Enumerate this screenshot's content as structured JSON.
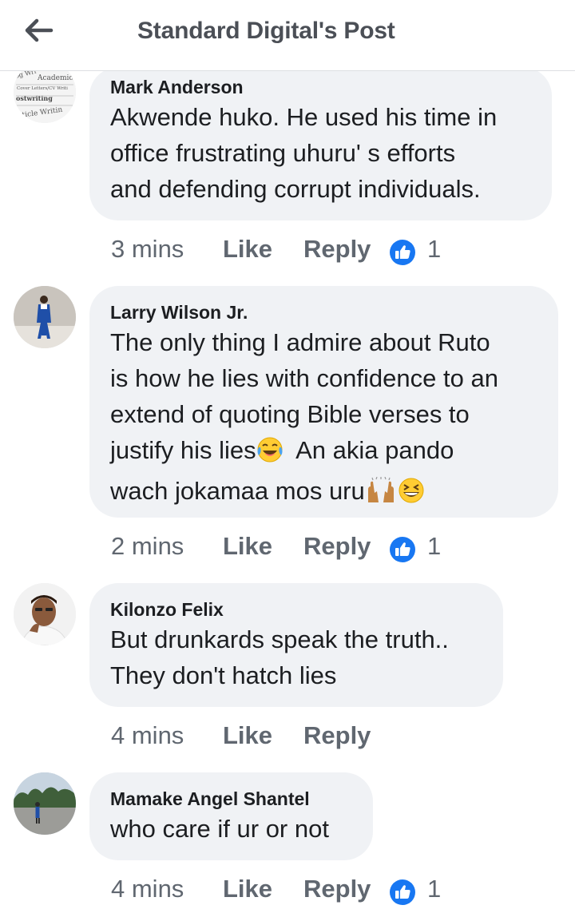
{
  "header": {
    "title": "Standard Digital's Post",
    "back_icon": "arrow-left-icon"
  },
  "colors": {
    "bubble": "#f0f2f5",
    "like_blue": "#1877f2",
    "meta_gray": "#606770"
  },
  "avatar_1_text": [
    "og Wri",
    "Academic",
    "Cover Letters/CV Writi",
    "ostwriting",
    "rticle Writin"
  ],
  "comments": [
    {
      "author": "Mark Anderson",
      "text": "Akwende huko. He used his time in\noffice frustrating uhuru' s efforts\nand defending corrupt individuals.",
      "time": "3 mins",
      "like": "Like",
      "reply": "Reply",
      "reaction_icon": "thumbs-up-icon",
      "reaction_count": "1"
    },
    {
      "author": "Larry Wilson Jr.",
      "text_parts": [
        "The only thing I admire about Ruto\nis how he lies with confidence to an\nextend of quoting Bible verses to\njustify his lies",
        "  An akia pando\nwach jokamaa mos uru",
        ""
      ],
      "emoji_icons": [
        "tears-of-joy-emoji-icon",
        "raised-hands-emoji-icon",
        "grinning-squinting-emoji-icon"
      ],
      "time": "2 mins",
      "like": "Like",
      "reply": "Reply",
      "reaction_icon": "thumbs-up-icon",
      "reaction_count": "1"
    },
    {
      "author": "Kilonzo Felix",
      "text": "But drunkards speak the truth..\nThey don't hatch lies",
      "time": "4 mins",
      "like": "Like",
      "reply": "Reply"
    },
    {
      "author": "Mamake Angel Shantel",
      "text": "who care if ur or not",
      "time": "4 mins",
      "like": "Like",
      "reply": "Reply",
      "reaction_icon": "thumbs-up-icon",
      "reaction_count": "1"
    }
  ]
}
